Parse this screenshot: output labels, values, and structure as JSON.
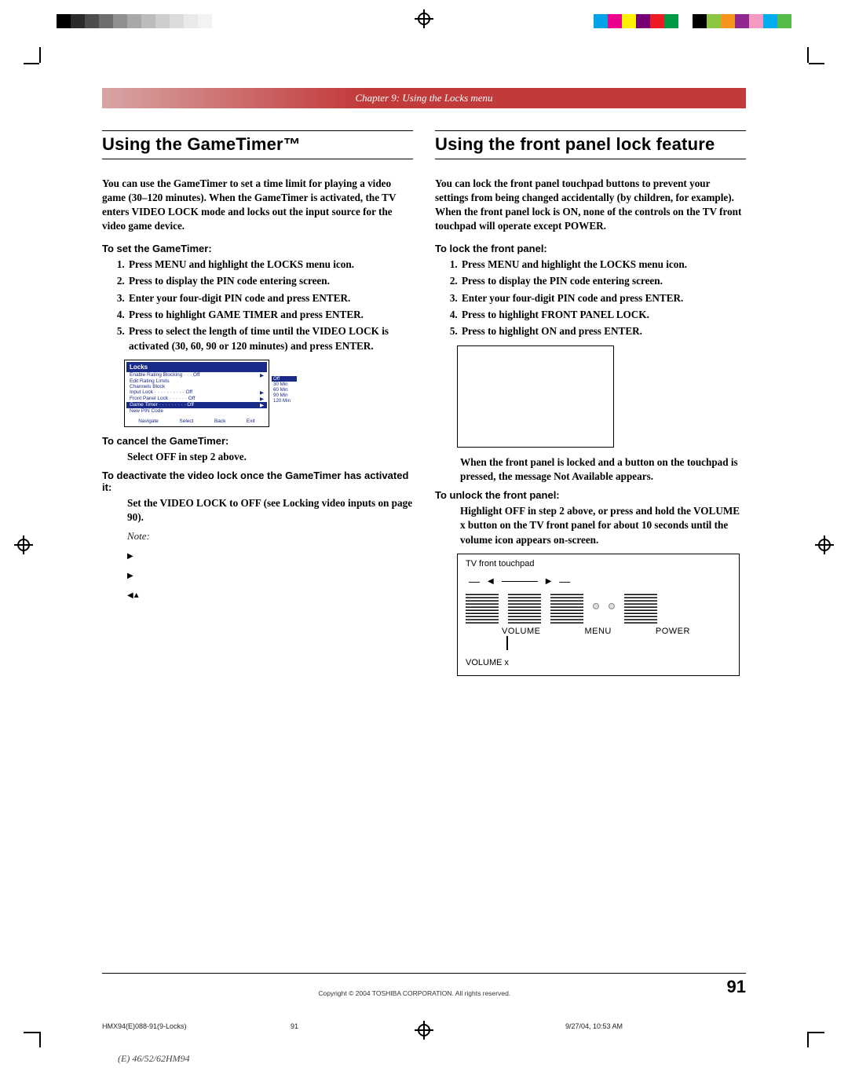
{
  "chapter_header": "Chapter 9: Using the Locks menu",
  "left": {
    "title": "Using the GameTimer™",
    "intro": "You can use the GameTimer to set a time limit for playing a video game (30–120 minutes). When the GameTimer is activated, the TV enters VIDEO LOCK mode and locks out the input source for the video game device.",
    "sub_set": "To set the GameTimer:",
    "steps_set": [
      "Press MENU and highlight the LOCKS menu icon.",
      "Press  to display the PIN code entering screen.",
      "Enter your four-digit PIN code and press ENTER.",
      "Press  to highlight GAME TIMER and press ENTER.",
      "Press  to select the length of time until the VIDEO LOCK is activated (30, 60, 90 or 120 minutes) and press ENTER."
    ],
    "menu": {
      "title": "Locks",
      "rows": [
        {
          "l": "Enable Rating Blocking · · · Off",
          "sel": false,
          "arrow": "▶"
        },
        {
          "l": "Edit Rating Limits",
          "sel": false,
          "arrow": ""
        },
        {
          "l": "Channels Block",
          "sel": false,
          "arrow": ""
        },
        {
          "l": "Input Lock · · · · · · · · · · Off",
          "sel": false,
          "arrow": "▶"
        },
        {
          "l": "Front Panel Lock · · · · · · Off",
          "sel": false,
          "arrow": "▶"
        },
        {
          "l": "Game Timer · · · · · · · · · Off",
          "sel": true,
          "arrow": "▶"
        },
        {
          "l": "New PIN Code",
          "sel": false,
          "arrow": ""
        }
      ],
      "nav": [
        "Navigate",
        "Select",
        "Back",
        "Exit"
      ],
      "popup": [
        "Off",
        "30 Min",
        "60 Min",
        "90 Min",
        "120 Min"
      ]
    },
    "sub_cancel": "To cancel the GameTimer:",
    "cancel_body": "Select OFF in step 2 above.",
    "sub_deact": "To deactivate the video lock once the GameTimer has activated it:",
    "deact_body": "Set the VIDEO LOCK to OFF (see Locking video inputs on page 90).",
    "note_label": "Note:"
  },
  "right": {
    "title": "Using the front panel lock feature",
    "intro": "You can lock the front panel touchpad buttons to prevent your settings from being changed accidentally (by children, for example). When the front panel lock is ON, none of the controls on the TV front touchpad will operate except POWER.",
    "sub_lock": "To lock the front panel:",
    "steps_lock": [
      "Press MENU and highlight the LOCKS menu icon.",
      "Press  to display the PIN code entering screen.",
      "Enter your four-digit PIN code and press ENTER.",
      "Press  to highlight FRONT PANEL LOCK.",
      "Press  to highlight ON and press ENTER."
    ],
    "locked_msg": "When the front panel is locked and a button on the touchpad is pressed, the message Not Available appears.",
    "sub_unlock": "To unlock the front panel:",
    "unlock_body": "Highlight OFF in step 2 above, or press and hold the VOLUME x button on the TV front panel for about 10 seconds until the volume icon appears on-screen.",
    "touchpad": {
      "label": "TV front touchpad",
      "vol": "VOLUME",
      "menu": "MENU",
      "power": "POWER",
      "volx": "VOLUME x"
    }
  },
  "copyright": "Copyright © 2004 TOSHIBA CORPORATION. All rights reserved.",
  "pagenum": "91",
  "slug_file": "HMX94(E)088-91(9-Locks)",
  "slug_page": "91",
  "slug_date": "9/27/04, 10:53 AM",
  "trim_text": "(E) 46/52/62HM94",
  "graybar": [
    "#000000",
    "#2b2b2b",
    "#4d4d4d",
    "#6e6e6e",
    "#8f8f8f",
    "#a8a8a8",
    "#bcbcbc",
    "#cecece",
    "#dcdcdc",
    "#eaeaea",
    "#f3f3f3",
    "#ffffff"
  ],
  "colorset": [
    "#00a2e8",
    "#ec008c",
    "#fff200",
    "#740074",
    "#ed1c24",
    "#009944",
    "#ffffff",
    "#000000",
    "#8dc73f",
    "#f7941d",
    "#92278f",
    "#f49ac1",
    "#00aeef",
    "#55bd47"
  ]
}
